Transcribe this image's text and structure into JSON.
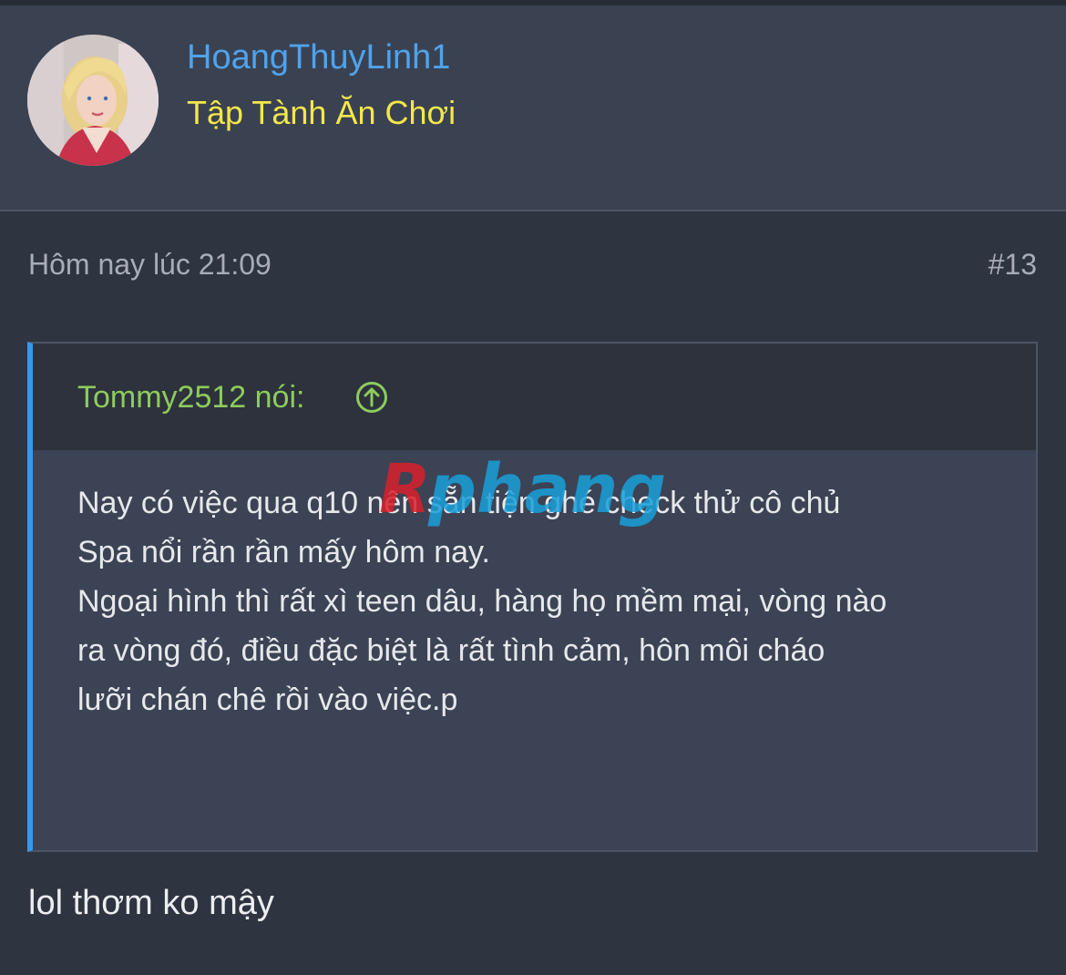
{
  "user": {
    "username": "HoangThuyLinh1",
    "title": "Tập Tành Ăn Chơi",
    "avatar_icon": "user-avatar"
  },
  "post": {
    "timestamp": "Hôm nay lúc 21:09",
    "number": "#13"
  },
  "quote": {
    "author": "Tommy2512 nói:",
    "jump_icon": "arrow-up-circle-icon",
    "lines": [
      "Nay có việc qua q10 nên sẵn tiện ghé check thử cô chủ",
      "Spa nổi rần rần mấy hôm nay.",
      "Ngoại hình thì rất xì teen dâu, hàng họ mềm mại, vòng nào",
      "ra vòng đó, điều đặc biệt là rất tình cảm, hôn môi cháo",
      "lưỡi chán chê rồi vào việc.p"
    ]
  },
  "watermark": {
    "text": "Rphang"
  },
  "reply": {
    "text": "lol thơm ko mậy"
  },
  "colors": {
    "background": "#2f3441",
    "header_bg": "#3a4252",
    "username": "#4fa3ec",
    "user_title": "#f3e74a",
    "quote_author": "#8dcc5c",
    "quote_border": "#3a97ea",
    "meta_text": "#a8adb7"
  }
}
